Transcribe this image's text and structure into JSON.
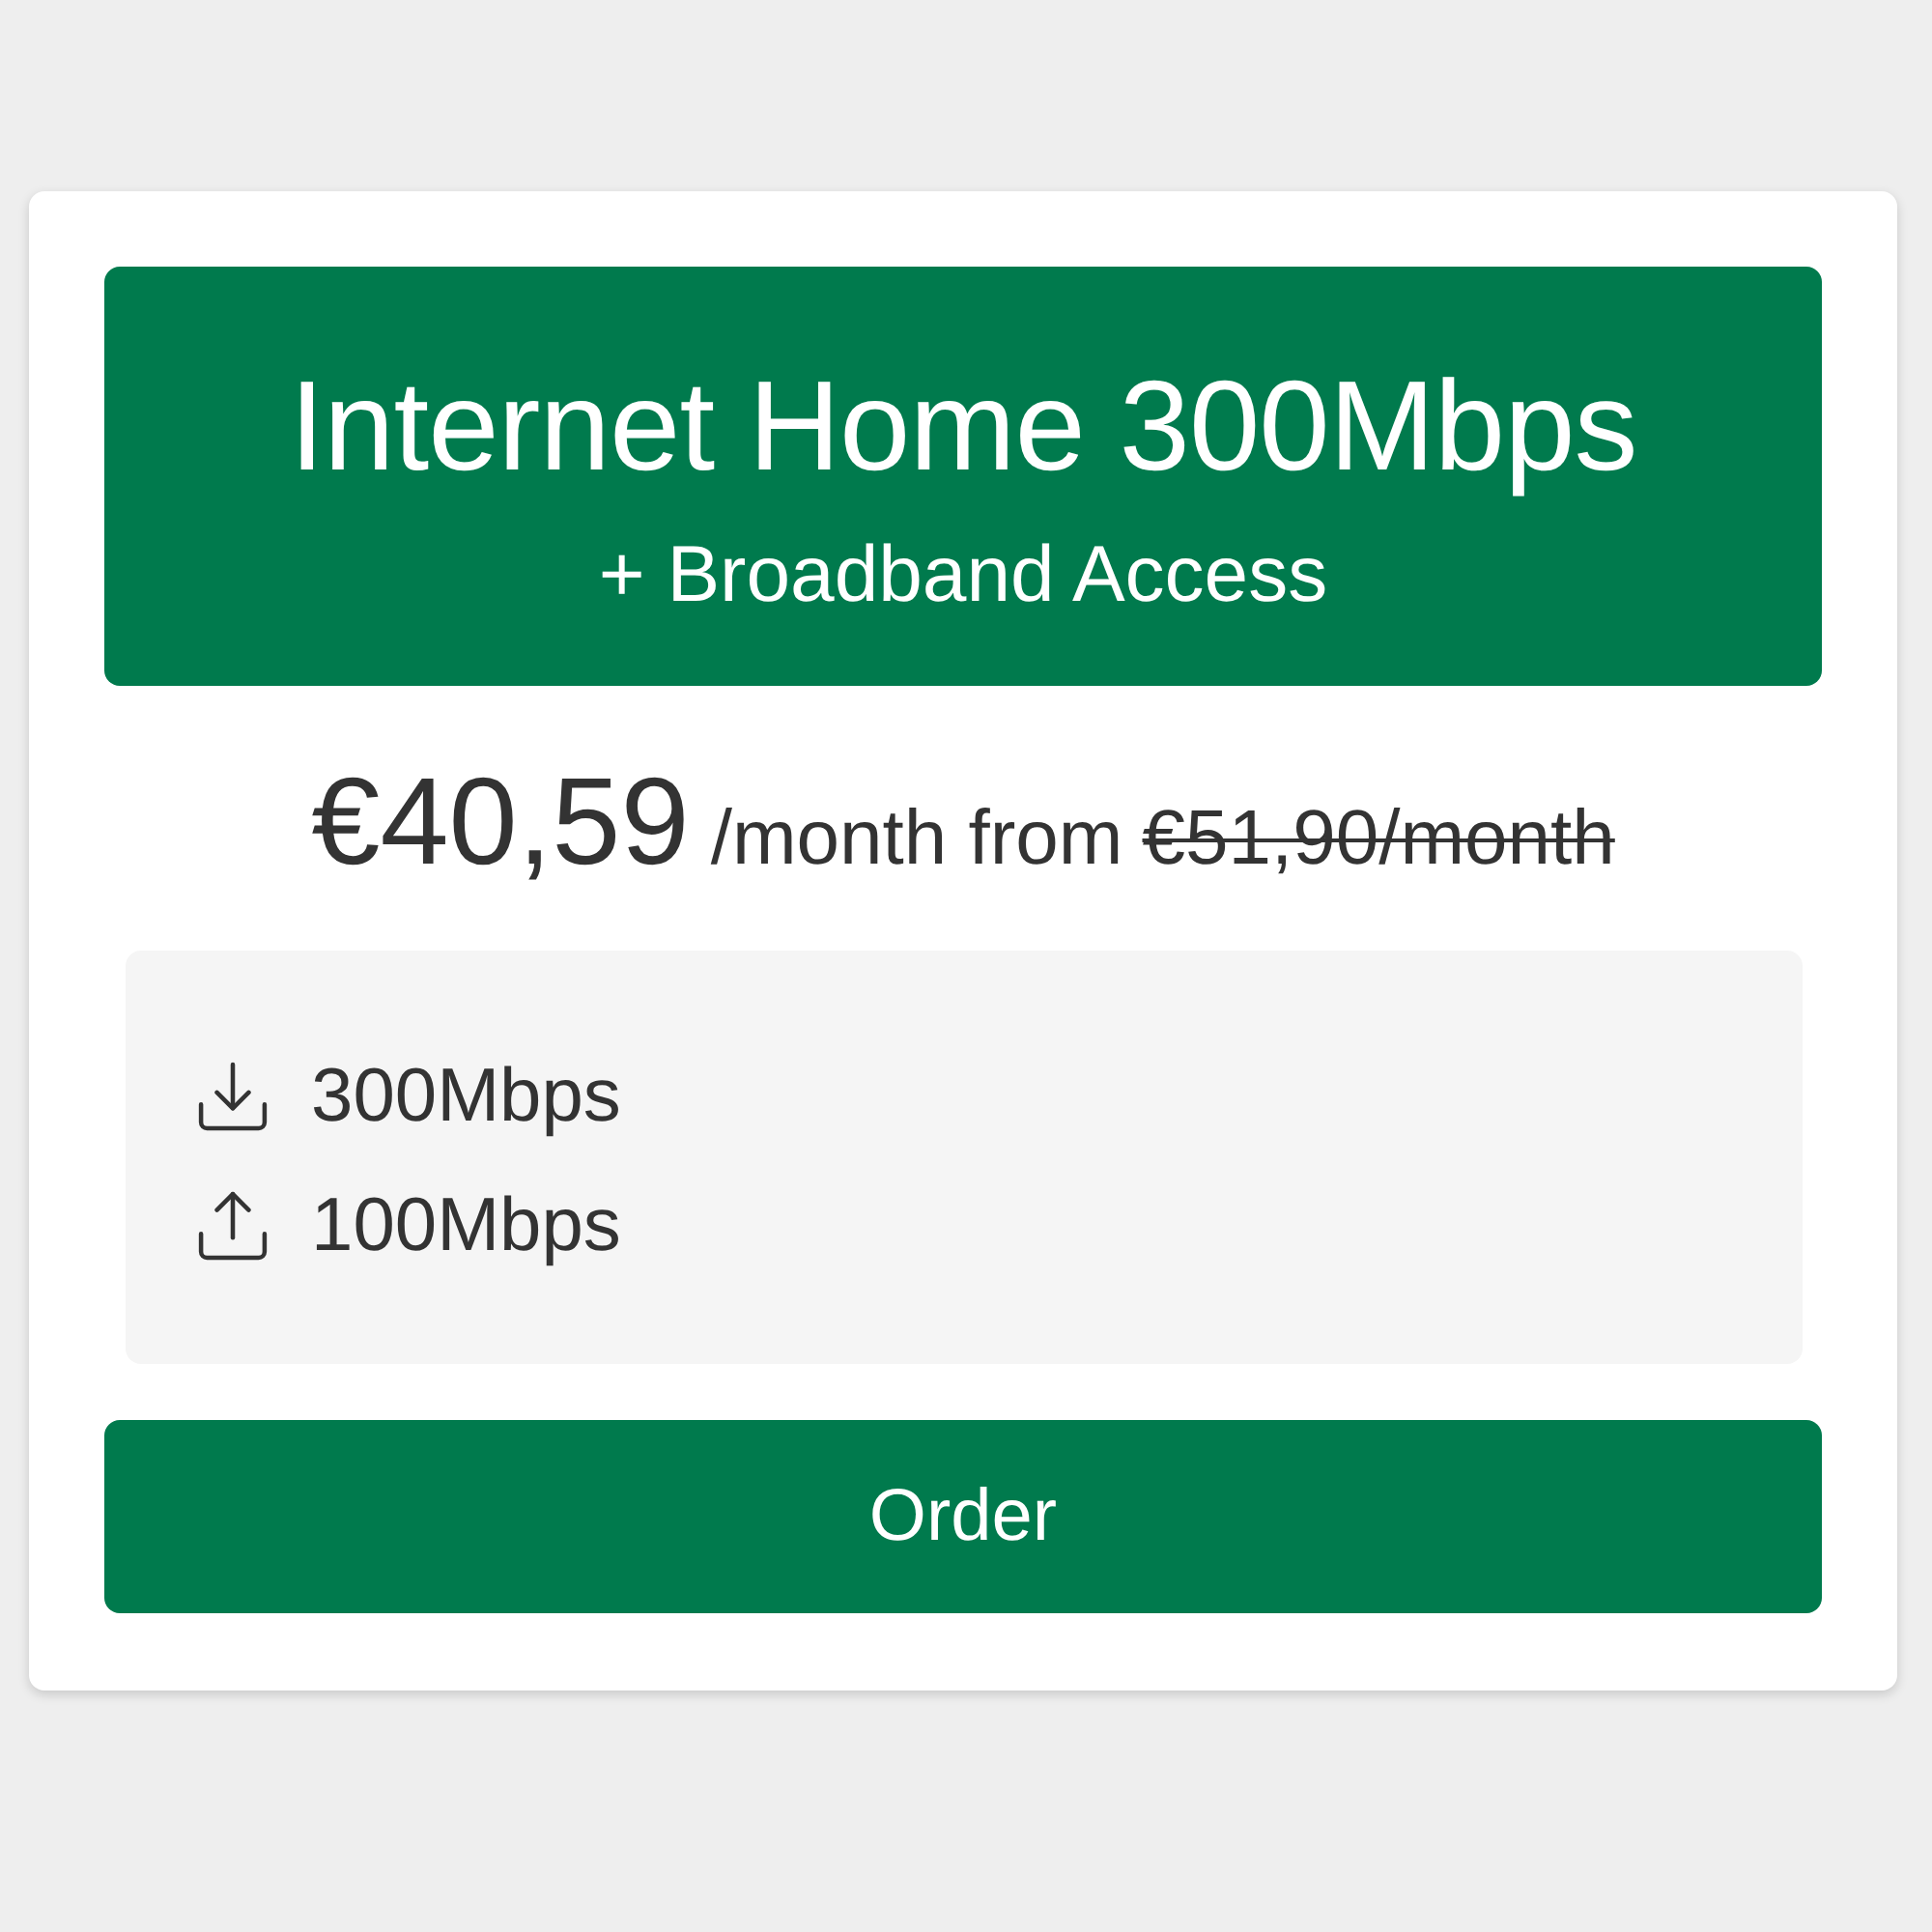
{
  "plan": {
    "title": "Internet Home 300Mbps",
    "subtitle": "+ Broadband Access"
  },
  "price": {
    "amount": "€40,59",
    "period": "/month from",
    "old_price": "€51,90/month"
  },
  "features": [
    {
      "kind": "download",
      "text": "300Mbps"
    },
    {
      "kind": "upload",
      "text": "100Mbps"
    }
  ],
  "order_button": {
    "label": "Order"
  }
}
